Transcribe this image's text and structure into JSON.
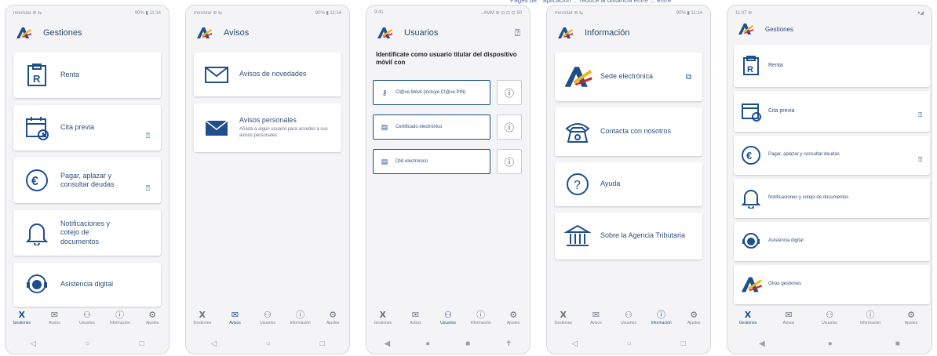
{
  "colors": {
    "accent": "#1e4f8c",
    "background": "#f4f4f6",
    "card": "#ffffff",
    "logo_yellow": "#f2b418",
    "logo_red": "#c8282d"
  },
  "top_banner": {
    "text": "Pages de: ' aplicación ... reduce la distancia entre ... entre"
  },
  "bottom_nav": {
    "items": [
      {
        "label": "Gestiones",
        "icon": "logo-icon"
      },
      {
        "label": "Avisos",
        "icon": "mail-icon"
      },
      {
        "label": "Usuarios",
        "icon": "users-icon"
      },
      {
        "label": "Información",
        "icon": "info-icon"
      },
      {
        "label": "Ajustes",
        "icon": "gear-icon"
      }
    ]
  },
  "screen1": {
    "status_left": "movistar ⊛ ⇆",
    "status_right": "90% ▮ 11:14",
    "title": "Gestiones",
    "cards": [
      {
        "label": "Renta",
        "icon": "renta-icon"
      },
      {
        "label": "Cita previa",
        "icon": "calendar-clock-icon",
        "help": "?"
      },
      {
        "label": "Pagar, aplazar y consultar deudas",
        "icon": "euro-icon",
        "help": "?"
      },
      {
        "label": "Notificaciones y cotejo de documentos",
        "icon": "bell-icon"
      },
      {
        "label": "Asistencia digital",
        "icon": "support-agent-icon"
      }
    ],
    "active_tab": "Gestiones"
  },
  "screen2": {
    "status_left": "movistar ⊛ ⇆",
    "status_right": "90% ▮ 11:14",
    "title": "Avisos",
    "cards": [
      {
        "label": "Avisos de novedades",
        "icon": "mail-outline-icon"
      },
      {
        "label": "Avisos personales",
        "sub": "Añada a algún usuario para acceder a sus avisos personales",
        "icon": "mail-filled-icon"
      }
    ],
    "active_tab": "Avisos"
  },
  "screen3": {
    "status_left": "9:41",
    "status_right": "..AMM ⊛ ⊡ ⊡ ⊡ 90",
    "title": "Usuarios",
    "prompt": "Identifícate como usuario titular del dispositivo móvil con",
    "options": [
      {
        "label": "Cl@ve Móvil (incluye Cl@ve PIN)",
        "icon": "key-icon"
      },
      {
        "label": "Certificado electrónico",
        "icon": "certificate-icon"
      },
      {
        "label": "DNI electrónico",
        "icon": "id-card-icon"
      }
    ],
    "active_tab": "Usuarios"
  },
  "screen4": {
    "status_left": "movistar ⊛ ⇆",
    "status_right": "90% ▮ 11:14",
    "title": "Información",
    "cards": [
      {
        "label": "Sede electrónica",
        "icon": "aeat-logo-icon"
      },
      {
        "label": "Contacta con nosotros",
        "icon": "phone-icon"
      },
      {
        "label": "Ayuda",
        "icon": "question-icon"
      },
      {
        "label": "Sobre la Agencia Tributaria",
        "icon": "building-icon"
      }
    ],
    "active_tab": "Información"
  },
  "screen5": {
    "status_left": "11:07 ⊛",
    "status_right": "▾◢",
    "title": "Gestiones",
    "cards": [
      {
        "label": "Renta",
        "icon": "renta-icon"
      },
      {
        "label": "Cita previa",
        "icon": "calendar-clock-icon",
        "help": "?"
      },
      {
        "label": "Pagar, aplazar y consultar deudas",
        "icon": "euro-icon",
        "help": "?"
      },
      {
        "label": "Notificaciones y cotejo de documentos",
        "icon": "bell-icon"
      },
      {
        "label": "Asistencia digital",
        "icon": "support-agent-icon"
      },
      {
        "label": "Otras gestiones",
        "icon": "aeat-logo-icon"
      }
    ],
    "active_tab": "Gestiones"
  }
}
